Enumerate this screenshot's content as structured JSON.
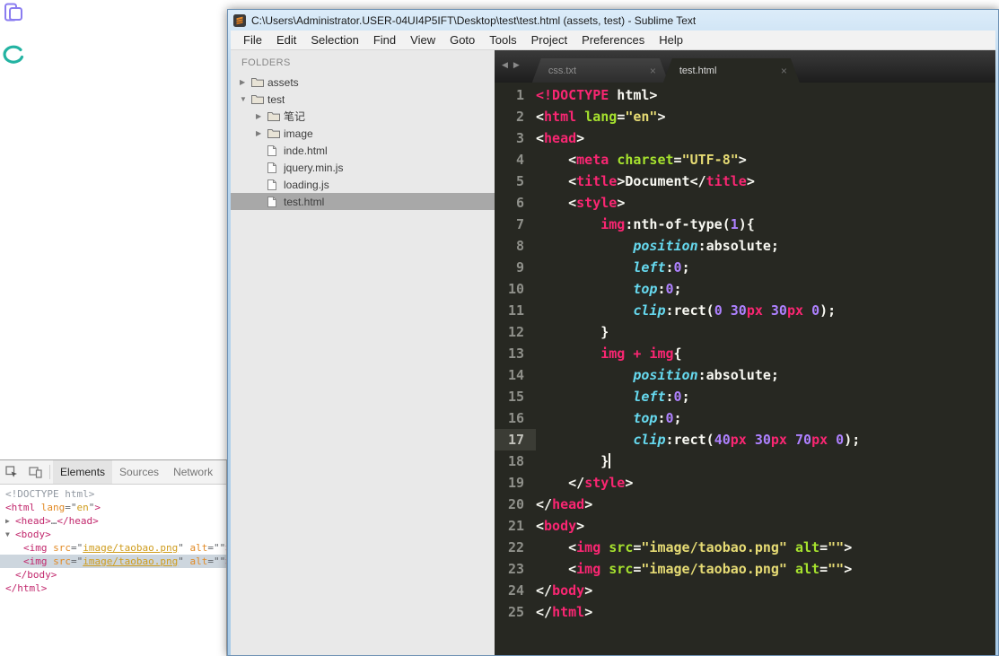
{
  "colors": {
    "editor_background": "#272822",
    "syntax_tag": "#f92672",
    "syntax_attribute": "#a6e22e",
    "syntax_string": "#e6db74",
    "syntax_property": "#66d9ef",
    "syntax_number": "#ae81ff",
    "sidebar_background": "#e9e9e9",
    "titlebar_blue": "#a9cbe8",
    "devtools_tag": "#c2286d",
    "devtools_attr": "#e28a25",
    "desktop_icon_purple": "#8a7cf0",
    "desktop_icon_teal": "#23b3a2"
  },
  "icons": {
    "close": "×",
    "collapsed": "▶",
    "expanded": "▼",
    "prev_tab": "◀",
    "next_tab": "▶"
  },
  "desktop": {
    "icons": [
      {
        "name": "purple-app-icon"
      },
      {
        "name": "teal-app-icon"
      }
    ]
  },
  "window": {
    "title": "C:\\Users\\Administrator.USER-04UI4P5IFT\\Desktop\\test\\test.html (assets, test) - Sublime Text",
    "menu": [
      "File",
      "Edit",
      "Selection",
      "Find",
      "View",
      "Goto",
      "Tools",
      "Project",
      "Preferences",
      "Help"
    ]
  },
  "sidebar": {
    "header": "FOLDERS",
    "items": [
      {
        "label": "assets",
        "type": "folder",
        "expanded": false,
        "depth": 0,
        "selected": false
      },
      {
        "label": "test",
        "type": "folder",
        "expanded": true,
        "depth": 0,
        "selected": false
      },
      {
        "label": "笔记",
        "type": "folder",
        "expanded": false,
        "depth": 1,
        "selected": false
      },
      {
        "label": "image",
        "type": "folder",
        "expanded": false,
        "depth": 1,
        "selected": false
      },
      {
        "label": "inde.html",
        "type": "file",
        "depth": 1,
        "selected": false
      },
      {
        "label": "jquery.min.js",
        "type": "file",
        "depth": 1,
        "selected": false
      },
      {
        "label": "loading.js",
        "type": "file",
        "depth": 1,
        "selected": false
      },
      {
        "label": "test.html",
        "type": "file",
        "depth": 1,
        "selected": true
      }
    ]
  },
  "editor_tabs": [
    {
      "label": "css.txt",
      "active": false
    },
    {
      "label": "test.html",
      "active": true
    }
  ],
  "editor": {
    "highlight_gutter_line": 17,
    "caret_line": 18,
    "lines": [
      [
        [
          "t",
          "<!DOCTYPE"
        ],
        [
          "d",
          " html>"
        ]
      ],
      [
        [
          "d",
          "<"
        ],
        [
          "t",
          "html"
        ],
        [
          "d",
          " "
        ],
        [
          "a",
          "lang"
        ],
        [
          "d",
          "="
        ],
        [
          "s",
          "\"en\""
        ],
        [
          "d",
          ">"
        ]
      ],
      [
        [
          "d",
          "<"
        ],
        [
          "t",
          "head"
        ],
        [
          "d",
          ">"
        ]
      ],
      [
        [
          "d",
          "    <"
        ],
        [
          "t",
          "meta"
        ],
        [
          "d",
          " "
        ],
        [
          "a",
          "charset"
        ],
        [
          "d",
          "="
        ],
        [
          "s",
          "\"UTF-8\""
        ],
        [
          "d",
          ">"
        ]
      ],
      [
        [
          "d",
          "    <"
        ],
        [
          "t",
          "title"
        ],
        [
          "d",
          ">Document</"
        ],
        [
          "t",
          "title"
        ],
        [
          "d",
          ">"
        ]
      ],
      [
        [
          "d",
          "    <"
        ],
        [
          "t",
          "style"
        ],
        [
          "d",
          ">"
        ]
      ],
      [
        [
          "d",
          "        "
        ],
        [
          "t",
          "img"
        ],
        [
          "d",
          ":nth-of-type("
        ],
        [
          "n",
          "1"
        ],
        [
          "d",
          "){"
        ]
      ],
      [
        [
          "d",
          "            "
        ],
        [
          "p",
          "position"
        ],
        [
          "d",
          ":absolute;"
        ]
      ],
      [
        [
          "d",
          "            "
        ],
        [
          "p",
          "left"
        ],
        [
          "d",
          ":"
        ],
        [
          "n",
          "0"
        ],
        [
          "d",
          ";"
        ]
      ],
      [
        [
          "d",
          "            "
        ],
        [
          "p",
          "top"
        ],
        [
          "d",
          ":"
        ],
        [
          "n",
          "0"
        ],
        [
          "d",
          ";"
        ]
      ],
      [
        [
          "d",
          "            "
        ],
        [
          "p",
          "clip"
        ],
        [
          "d",
          ":rect("
        ],
        [
          "n",
          "0"
        ],
        [
          "d",
          " "
        ],
        [
          "n",
          "30"
        ],
        [
          "u",
          "px"
        ],
        [
          "d",
          " "
        ],
        [
          "n",
          "30"
        ],
        [
          "u",
          "px"
        ],
        [
          "d",
          " "
        ],
        [
          "n",
          "0"
        ],
        [
          "d",
          ");"
        ]
      ],
      [
        [
          "d",
          "        }"
        ]
      ],
      [
        [
          "d",
          "        "
        ],
        [
          "t",
          "img"
        ],
        [
          "d",
          " "
        ],
        [
          "t",
          "+"
        ],
        [
          "d",
          " "
        ],
        [
          "t",
          "img"
        ],
        [
          "d",
          "{"
        ]
      ],
      [
        [
          "d",
          "            "
        ],
        [
          "p",
          "position"
        ],
        [
          "d",
          ":absolute;"
        ]
      ],
      [
        [
          "d",
          "            "
        ],
        [
          "p",
          "left"
        ],
        [
          "d",
          ":"
        ],
        [
          "n",
          "0"
        ],
        [
          "d",
          ";"
        ]
      ],
      [
        [
          "d",
          "            "
        ],
        [
          "p",
          "top"
        ],
        [
          "d",
          ":"
        ],
        [
          "n",
          "0"
        ],
        [
          "d",
          ";"
        ]
      ],
      [
        [
          "d",
          "            "
        ],
        [
          "p",
          "clip"
        ],
        [
          "d",
          ":rect("
        ],
        [
          "n",
          "40"
        ],
        [
          "u",
          "px"
        ],
        [
          "d",
          " "
        ],
        [
          "n",
          "30"
        ],
        [
          "u",
          "px"
        ],
        [
          "d",
          " "
        ],
        [
          "n",
          "70"
        ],
        [
          "u",
          "px"
        ],
        [
          "d",
          " "
        ],
        [
          "n",
          "0"
        ],
        [
          "d",
          ");"
        ]
      ],
      [
        [
          "d",
          "        }"
        ]
      ],
      [
        [
          "d",
          "    </"
        ],
        [
          "t",
          "style"
        ],
        [
          "d",
          ">"
        ]
      ],
      [
        [
          "d",
          "</"
        ],
        [
          "t",
          "head"
        ],
        [
          "d",
          ">"
        ]
      ],
      [
        [
          "d",
          "<"
        ],
        [
          "t",
          "body"
        ],
        [
          "d",
          ">"
        ]
      ],
      [
        [
          "d",
          "    <"
        ],
        [
          "t",
          "img"
        ],
        [
          "d",
          " "
        ],
        [
          "a",
          "src"
        ],
        [
          "d",
          "="
        ],
        [
          "s",
          "\"image/taobao.png\""
        ],
        [
          "d",
          " "
        ],
        [
          "a",
          "alt"
        ],
        [
          "d",
          "="
        ],
        [
          "s",
          "\"\""
        ],
        [
          "d",
          ">"
        ]
      ],
      [
        [
          "d",
          "    <"
        ],
        [
          "t",
          "img"
        ],
        [
          "d",
          " "
        ],
        [
          "a",
          "src"
        ],
        [
          "d",
          "="
        ],
        [
          "s",
          "\"image/taobao.png\""
        ],
        [
          "d",
          " "
        ],
        [
          "a",
          "alt"
        ],
        [
          "d",
          "="
        ],
        [
          "s",
          "\"\""
        ],
        [
          "d",
          ">"
        ]
      ],
      [
        [
          "d",
          "</"
        ],
        [
          "t",
          "body"
        ],
        [
          "d",
          ">"
        ]
      ],
      [
        [
          "d",
          "</"
        ],
        [
          "t",
          "html"
        ],
        [
          "d",
          ">"
        ]
      ]
    ]
  },
  "devtools": {
    "tabs": [
      "Elements",
      "Sources",
      "Network"
    ],
    "active_tab": "Elements",
    "toolbar_icons": [
      "inspect-icon",
      "device-toolbar-icon"
    ],
    "tree": [
      {
        "indent": 0,
        "arrow": null,
        "inset": false,
        "selected": false,
        "segs": [
          [
            "g",
            "<!DOCTYPE html>"
          ]
        ]
      },
      {
        "indent": 0,
        "arrow": null,
        "inset": false,
        "selected": false,
        "segs": [
          [
            "t",
            "<html"
          ],
          [
            "d",
            " "
          ],
          [
            "a",
            "lang"
          ],
          [
            "d",
            "=\""
          ],
          [
            "v",
            "en"
          ],
          [
            "d",
            "\""
          ],
          [
            "t",
            ">"
          ]
        ]
      },
      {
        "indent": 0,
        "arrow": "right",
        "inset": false,
        "selected": false,
        "segs": [
          [
            "t",
            "<head>"
          ],
          [
            "d",
            "…"
          ],
          [
            "t",
            "</head>"
          ]
        ]
      },
      {
        "indent": 0,
        "arrow": "down",
        "inset": false,
        "selected": false,
        "segs": [
          [
            "t",
            "<body>"
          ]
        ]
      },
      {
        "indent": 1,
        "arrow": null,
        "inset": false,
        "selected": false,
        "segs": [
          [
            "t",
            "<img"
          ],
          [
            "d",
            " "
          ],
          [
            "a",
            "src"
          ],
          [
            "d",
            "=\""
          ],
          [
            "l",
            "image/taobao.png"
          ],
          [
            "d",
            "\" "
          ],
          [
            "a",
            "alt"
          ],
          [
            "d",
            "=\""
          ],
          [
            "d",
            "\""
          ],
          [
            "t",
            ">"
          ]
        ]
      },
      {
        "indent": 1,
        "arrow": null,
        "inset": false,
        "selected": true,
        "segs": [
          [
            "t",
            "<img"
          ],
          [
            "d",
            " "
          ],
          [
            "a",
            "src"
          ],
          [
            "d",
            "=\""
          ],
          [
            "l",
            "image/taobao.png"
          ],
          [
            "d",
            "\" "
          ],
          [
            "a",
            "alt"
          ],
          [
            "d",
            "=\""
          ],
          [
            "d",
            "\""
          ],
          [
            "t",
            ">"
          ]
        ]
      },
      {
        "indent": 0,
        "arrow": null,
        "inset": true,
        "selected": false,
        "segs": [
          [
            "t",
            "</body>"
          ]
        ]
      },
      {
        "indent": 0,
        "arrow": null,
        "inset": false,
        "selected": false,
        "segs": [
          [
            "t",
            "</html>"
          ]
        ]
      }
    ]
  }
}
